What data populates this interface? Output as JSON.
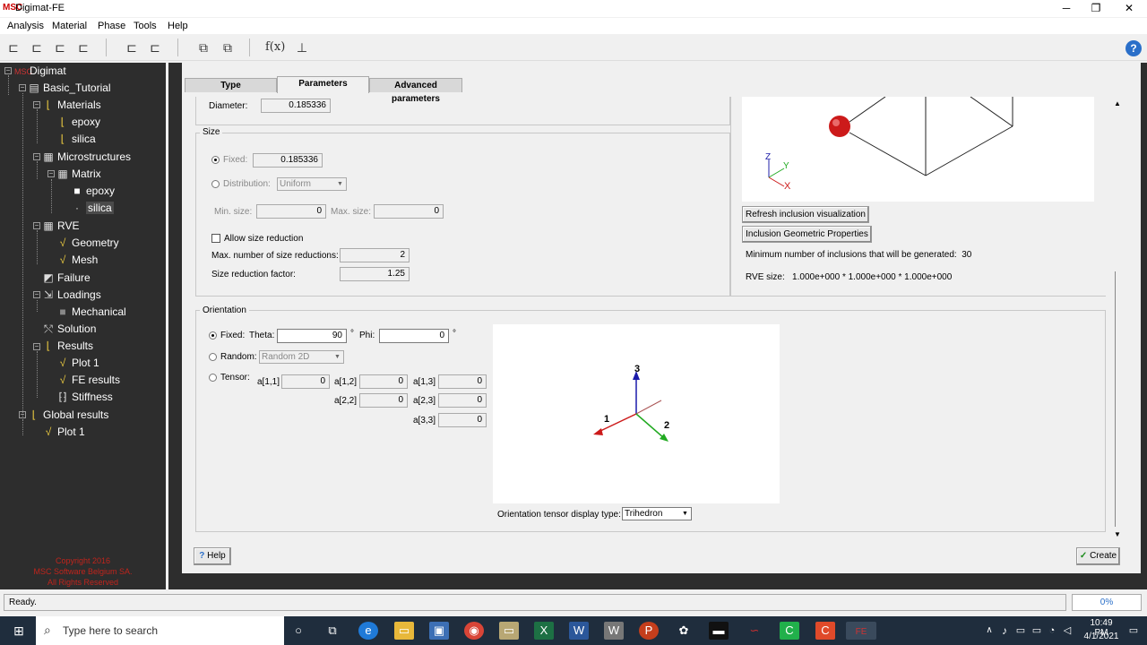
{
  "window": {
    "title": "Digimat-FE",
    "logo": "MSC",
    "min": "─",
    "max": "❐",
    "close": "✕"
  },
  "menu": [
    "Analysis",
    "Material",
    "Phase",
    "Tools",
    "Help"
  ],
  "tree": {
    "root": "Digimat",
    "analysis": "Basic_Tutorial",
    "materials": "Materials",
    "material_1": "epoxy",
    "material_2": "silica",
    "microstructures": "Microstructures",
    "matrix": "Matrix",
    "phase_1": "epoxy",
    "phase_2": "silica",
    "rve": "RVE",
    "geometry": "Geometry",
    "mesh": "Mesh",
    "failure": "Failure",
    "loadings": "Loadings",
    "mechanical": "Mechanical",
    "solution": "Solution",
    "results": "Results",
    "plot1": "Plot 1",
    "fe_results": "FE results",
    "stiffness": "Stiffness",
    "global_results": "Global results",
    "global_plot1": "Plot 1"
  },
  "copyright": [
    "Copyright 2016",
    "MSC Software Belgium SA.",
    "All Rights Reserved"
  ],
  "tabs": [
    "Type",
    "Parameters",
    "Advanced parameters"
  ],
  "diameter": {
    "label": "Diameter:",
    "value": "0.185336"
  },
  "size": {
    "group": "Size",
    "fixed_label": "Fixed:",
    "fixed_value": "0.185336",
    "distribution_label": "Distribution:",
    "distribution_value": "Uniform",
    "min_label": "Min. size:",
    "min_value": "0",
    "max_label": "Max. size:",
    "max_value": "0",
    "allow_reduction": "Allow size reduction",
    "max_reductions_label": "Max. number of size reductions:",
    "max_reductions_value": "2",
    "reduction_factor_label": "Size reduction factor:",
    "reduction_factor_value": "1.25"
  },
  "viz": {
    "refresh_button": "Refresh inclusion visualization",
    "geom_button": "Inclusion Geometric Properties",
    "min_inclusions": "Minimum number of inclusions that will be generated:  30",
    "rve_size": "RVE size:   1.000e+000 * 1.000e+000 * 1.000e+000",
    "axis_z": "Z",
    "axis_y": "Y",
    "axis_x": "X"
  },
  "orientation": {
    "group": "Orientation",
    "fixed_label": "Fixed:",
    "theta_label": "Theta:",
    "theta_value": "90",
    "deg": "°",
    "phi_label": "Phi:",
    "phi_value": "0",
    "random_label": "Random:",
    "random_value": "Random 2D",
    "tensor_label": "Tensor:",
    "a11_label": "a[1,1]",
    "a11": "0",
    "a12_label": "a[1,2]",
    "a12": "0",
    "a13_label": "a[1,3]",
    "a13": "0",
    "a22_label": "a[2,2]",
    "a22": "0",
    "a23_label": "a[2,3]",
    "a23": "0",
    "a33_label": "a[3,3]",
    "a33": "0",
    "display_label": "Orientation tensor display type:",
    "display_value": "Trihedron",
    "axis1": "1",
    "axis2": "2",
    "axis3": "3"
  },
  "buttons": {
    "help": "Help",
    "create": "Create"
  },
  "status": {
    "text": "Ready.",
    "progress": "0%"
  },
  "taskbar": {
    "search_placeholder": "Type here to search",
    "time": "10:49 PM",
    "date": "4/1/2021"
  },
  "colors": {
    "tree_bg": "#2d2d2d",
    "copyright": "#c0241c",
    "taskbar": "#1f2d3d",
    "inclusion": "#cc1a1a"
  }
}
